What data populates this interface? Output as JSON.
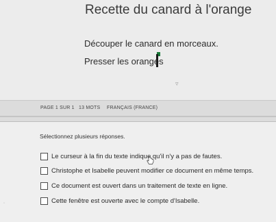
{
  "document": {
    "title": "Recette du canard à l'orange",
    "lines": [
      "Découper le canard en morceaux.",
      "Presser les oranges"
    ]
  },
  "status_bar": {
    "page": "PAGE 1 SUR 1",
    "words": "13 MOTS",
    "language": "FRANÇAIS (FRANCE)"
  },
  "question": {
    "prompt": "Sélectionnez plusieurs réponses.",
    "options": [
      "Le curseur à la fin du texte indique qu'il n'y a pas de fautes.",
      "Christophe et Isabelle peuvent modifier ce document en même temps.",
      "Ce document est ouvert dans un traitement de texte en ligne.",
      "Cette fenêtre est ouverte avec le compte d'Isabelle."
    ]
  }
}
